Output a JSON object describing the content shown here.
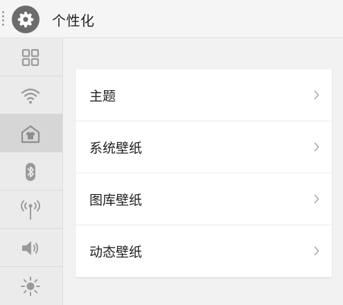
{
  "header": {
    "title": "个性化",
    "app_icon": "gear-icon"
  },
  "sidebar": {
    "items": [
      {
        "name": "apps",
        "icon": "grid-icon",
        "active": false
      },
      {
        "name": "wifi",
        "icon": "wifi-icon",
        "active": false
      },
      {
        "name": "personalization",
        "icon": "theme-shirt-icon",
        "active": true
      },
      {
        "name": "bluetooth",
        "icon": "bluetooth-icon",
        "active": false
      },
      {
        "name": "hotspot",
        "icon": "antenna-icon",
        "active": false
      },
      {
        "name": "sound",
        "icon": "speaker-icon",
        "active": false
      },
      {
        "name": "display",
        "icon": "brightness-icon",
        "active": false
      }
    ]
  },
  "main": {
    "items": [
      {
        "label": "主题"
      },
      {
        "label": "系统壁纸"
      },
      {
        "label": "图库壁纸"
      },
      {
        "label": "动态壁纸"
      }
    ]
  },
  "colors": {
    "background": "#f2f2f2",
    "sidebar": "#ebebeb",
    "sidebar_active": "#d6d6d6",
    "icon": "#9a9a9a",
    "text": "#1e1e1e"
  }
}
